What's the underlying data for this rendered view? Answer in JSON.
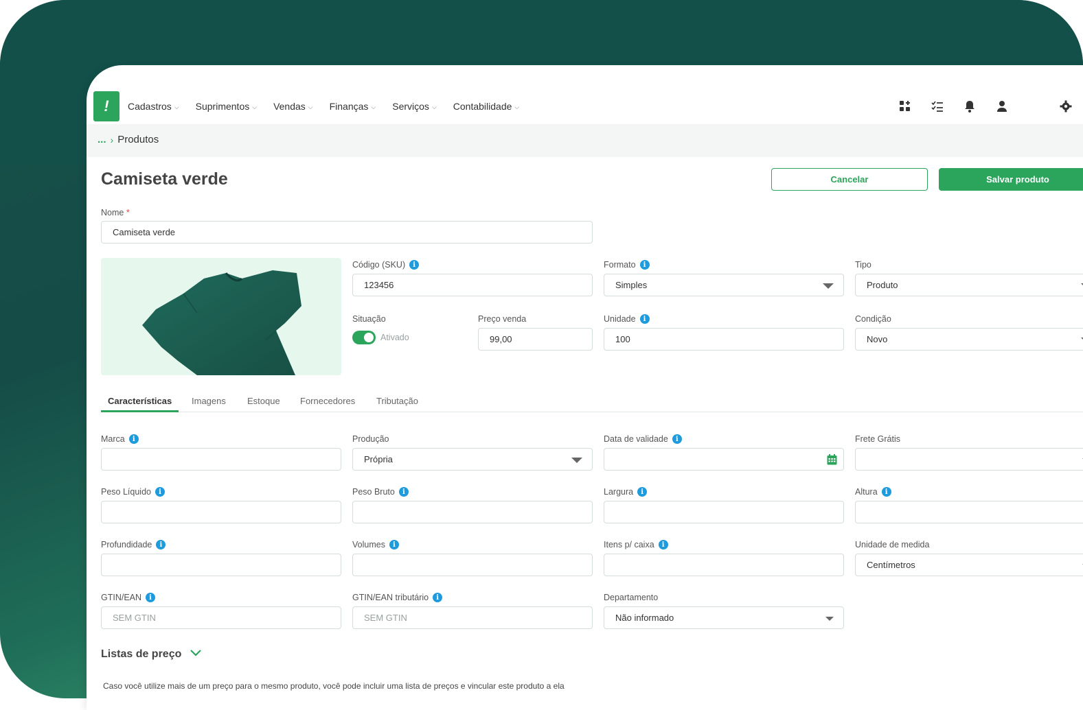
{
  "nav": {
    "menu": [
      {
        "label": "Cadastros"
      },
      {
        "label": "Suprimentos"
      },
      {
        "label": "Vendas"
      },
      {
        "label": "Finanças"
      },
      {
        "label": "Serviços"
      },
      {
        "label": "Contabilidade"
      }
    ],
    "icons": [
      "add-widget-icon",
      "checklist-icon",
      "bell-icon",
      "user-icon",
      "gear-icon"
    ]
  },
  "breadcrumb": {
    "ellipsis": "...",
    "current": "Produtos"
  },
  "page": {
    "title": "Camiseta verde"
  },
  "actions": {
    "cancel": "Cancelar",
    "save": "Salvar produto"
  },
  "form": {
    "nome": {
      "label": "Nome",
      "required": "*",
      "value": "Camiseta verde"
    },
    "sku": {
      "label": "Código (SKU)",
      "value": "123456"
    },
    "formato": {
      "label": "Formato",
      "value": "Simples"
    },
    "tipo": {
      "label": "Tipo",
      "value": "Produto"
    },
    "situacao": {
      "label": "Situação",
      "value": "Ativado",
      "on": true
    },
    "preco": {
      "label": "Preço venda",
      "value": "99,00"
    },
    "unidade": {
      "label": "Unidade",
      "value": "100"
    },
    "condicao": {
      "label": "Condição",
      "value": "Novo"
    }
  },
  "tabs": [
    "Características",
    "Imagens",
    "Estoque",
    "Fornecedores",
    "Tributação"
  ],
  "caracteristicas": {
    "marca": {
      "label": "Marca",
      "value": ""
    },
    "producao": {
      "label": "Produção",
      "value": "Própria"
    },
    "validade": {
      "label": "Data de validade",
      "value": ""
    },
    "frete": {
      "label": "Frete Grátis",
      "value": ""
    },
    "peso_liquido": {
      "label": "Peso Líquido",
      "value": ""
    },
    "peso_bruto": {
      "label": "Peso Bruto",
      "value": ""
    },
    "largura": {
      "label": "Largura",
      "value": ""
    },
    "altura": {
      "label": "Altura",
      "value": ""
    },
    "profundidade": {
      "label": "Profundidade",
      "value": ""
    },
    "volumes": {
      "label": "Volumes",
      "value": ""
    },
    "itens_caixa": {
      "label": "Itens p/ caixa",
      "value": ""
    },
    "unidade_medida": {
      "label": "Unidade de medida",
      "value": "Centímetros"
    },
    "gtin": {
      "label": "GTIN/EAN",
      "placeholder": "SEM GTIN"
    },
    "gtin_trib": {
      "label": "GTIN/EAN tributário",
      "placeholder": "SEM GTIN"
    },
    "departamento": {
      "label": "Departamento",
      "value": "Não informado"
    }
  },
  "listas": {
    "title": "Listas de preço",
    "description": "Caso você utilize mais de um preço para o mesmo produto, você pode incluir uma lista de preços e vincular este produto a ela"
  },
  "colors": {
    "brand": "#2ba45c",
    "info": "#1e9bdc",
    "backdrop": "#13504a"
  }
}
